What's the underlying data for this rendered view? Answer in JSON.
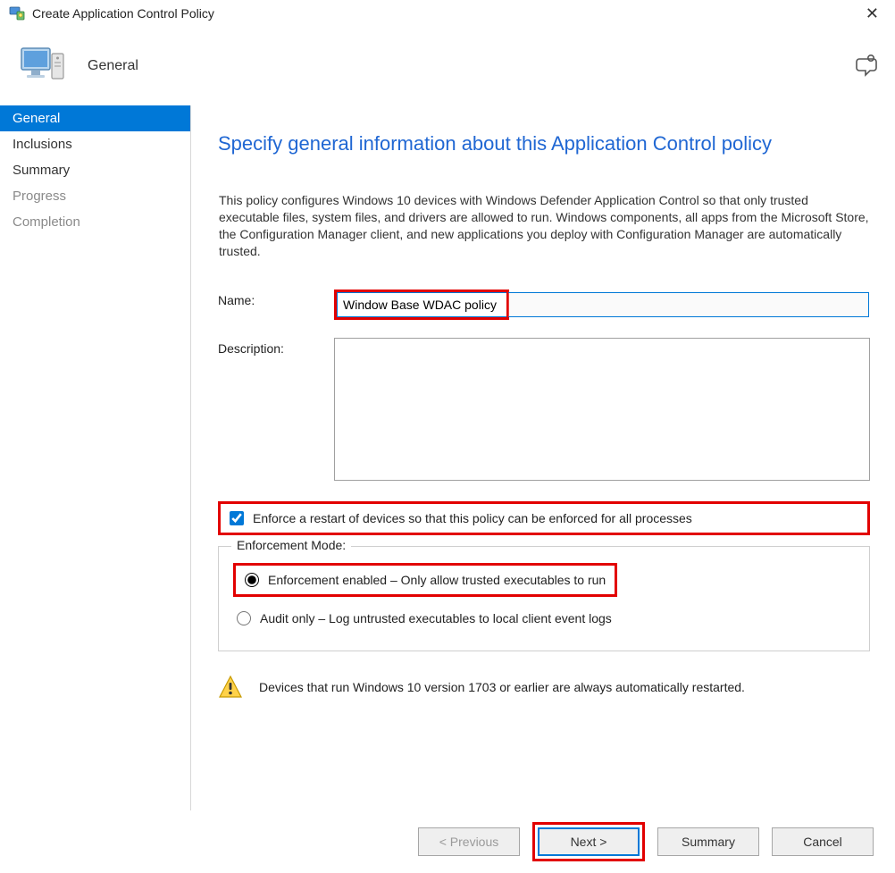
{
  "window": {
    "title": "Create Application Control Policy"
  },
  "header": {
    "label": "General"
  },
  "sidebar": {
    "steps": [
      {
        "label": "General",
        "state": "active"
      },
      {
        "label": "Inclusions",
        "state": "normal"
      },
      {
        "label": "Summary",
        "state": "normal"
      },
      {
        "label": "Progress",
        "state": "disabled"
      },
      {
        "label": "Completion",
        "state": "disabled"
      }
    ]
  },
  "main": {
    "title": "Specify general information about this Application Control policy",
    "intro": "This policy configures Windows 10 devices with Windows Defender Application Control so that only trusted executable files, system files, and drivers are allowed to run. Windows components, all apps from the Microsoft Store, the Configuration Manager client, and new applications you deploy with Configuration Manager are automatically trusted.",
    "name_label": "Name:",
    "name_value": "Window Base WDAC policy",
    "description_label": "Description:",
    "description_value": "",
    "restart_checked": true,
    "restart_label": "Enforce a restart of devices so that this policy can be enforced for all processes",
    "enforcement_legend": "Enforcement Mode:",
    "enforcement_selected": "enforce",
    "enforce_label": "Enforcement enabled – Only allow trusted executables to run",
    "audit_label": "Audit only – Log untrusted executables to local client event logs",
    "note": "Devices that run Windows 10 version 1703 or earlier are always automatically restarted."
  },
  "footer": {
    "previous": "< Previous",
    "next": "Next >",
    "summary": "Summary",
    "cancel": "Cancel"
  }
}
